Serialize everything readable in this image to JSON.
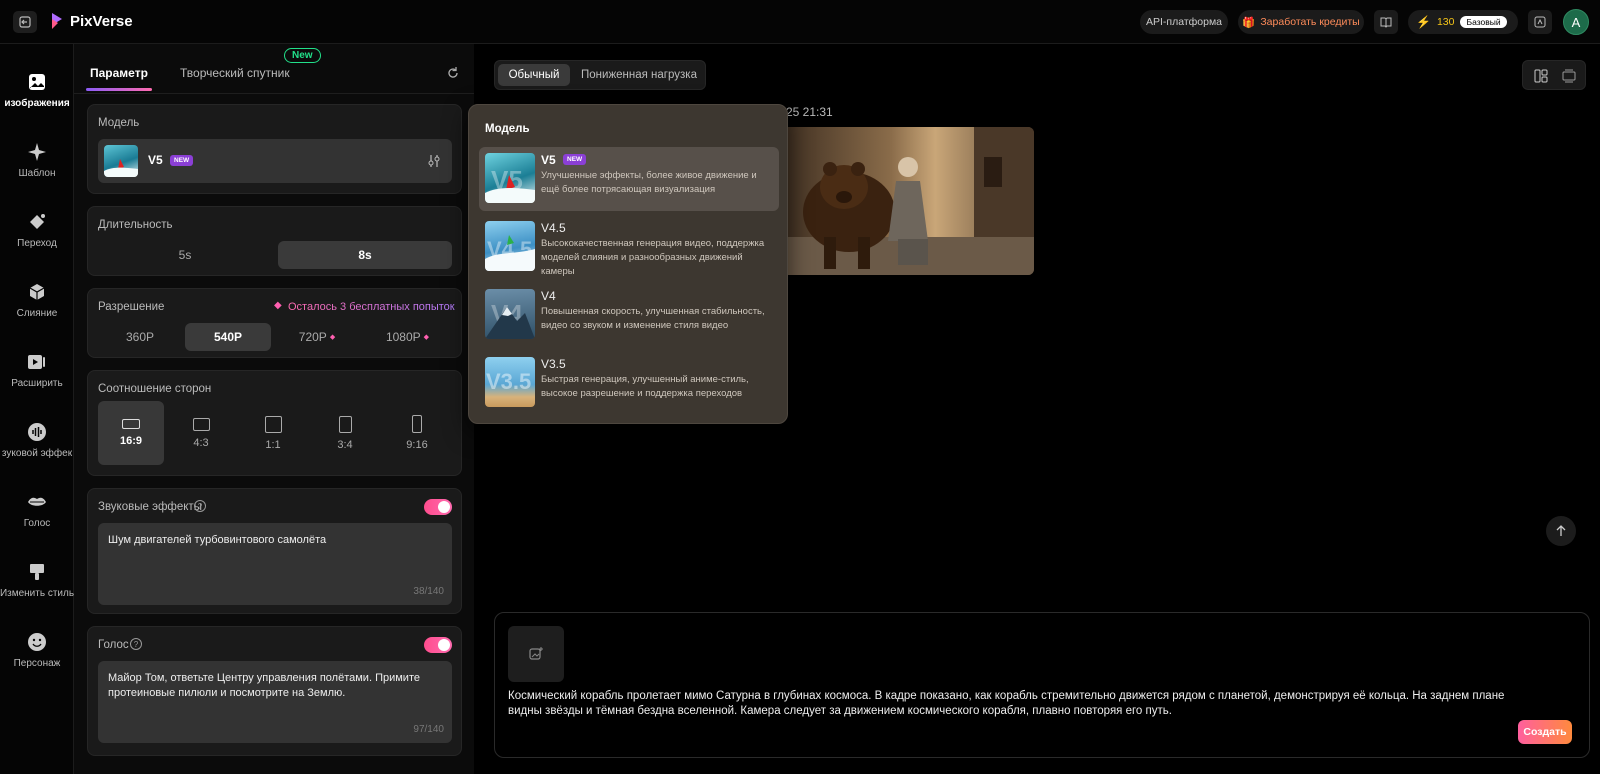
{
  "app": {
    "name": "PixVerse"
  },
  "topbar": {
    "api_label": "API-платформа",
    "earn_label": "Заработать кредиты",
    "credits": "130",
    "plan": "Базовый",
    "avatar_letter": "A"
  },
  "rail": [
    {
      "label": "изображения",
      "icon": "image-icon"
    },
    {
      "label": "Шаблон",
      "icon": "sparkle-icon"
    },
    {
      "label": "Переход",
      "icon": "transition-icon"
    },
    {
      "label": "Слияние",
      "icon": "cube-icon"
    },
    {
      "label": "Расширить",
      "icon": "extend-icon"
    },
    {
      "label": "зуковой эффек",
      "icon": "sound-wave-icon"
    },
    {
      "label": "Голос",
      "icon": "lips-icon"
    },
    {
      "label": "Изменить стиль",
      "icon": "brush-icon"
    },
    {
      "label": "Персонаж",
      "icon": "face-icon"
    }
  ],
  "settings": {
    "tabs": [
      "Параметр",
      "Творческий спутник"
    ],
    "new_badge": "New",
    "model": {
      "label": "Модель",
      "value": "V5",
      "badge": "NEW"
    },
    "duration": {
      "label": "Длительность",
      "options": [
        "5s",
        "8s"
      ],
      "selected": "8s"
    },
    "resolution": {
      "label": "Разрешение",
      "note": "Осталось 3 бесплатных попыток",
      "options": [
        "360P",
        "540P",
        "720P",
        "1080P"
      ],
      "selected": "540P"
    },
    "aspect": {
      "label": "Соотношение сторон",
      "options": [
        "16:9",
        "4:3",
        "1:1",
        "3:4",
        "9:16"
      ],
      "selected": "16:9"
    },
    "sound": {
      "label": "Звуковые эффекты",
      "text": "Шум двигателей турбовинтового самолёта",
      "counter": "38/140",
      "enabled": true
    },
    "voice": {
      "label": "Голос",
      "text": "Майор Том, ответьте Центру управления полётами. Примите протеиновые пилюли и посмотрите на Землю.",
      "counter": "97/140",
      "enabled": true
    }
  },
  "main": {
    "modes": [
      "Обычный",
      "Пониженная нагрузка"
    ],
    "selected_mode": "Обычный",
    "timestamp": "-25 21:31",
    "prompt": "Космический корабль пролетает мимо Сатурна в глубинах космоса. В кадре показано, как корабль стремительно движется рядом с планетой, демонстрируя её кольца. На заднем плане видны звёзды и тёмная бездна вселенной. Камера следует за движением космического корабля, плавно повторяя его путь.",
    "create_label": "Создать"
  },
  "dropdown": {
    "title": "Модель",
    "items": [
      {
        "name": "V5",
        "badge": "NEW",
        "desc": "Улучшенные эффекты, более живое движение и ещё более потрясающая визуализация",
        "active": true
      },
      {
        "name": "V4.5",
        "desc": "Высококачественная генерация видео, поддержка моделей слияния и разнообразных движений камеры"
      },
      {
        "name": "V4",
        "desc": "Повышенная скорость, улучшенная стабильность, видео со звуком и изменение стиля видео"
      },
      {
        "name": "V3.5",
        "desc": "Быстрая генерация, улучшенный аниме-стиль, высокое разрешение и поддержка переходов"
      }
    ]
  },
  "colors": {
    "accent_pink": "#ff4d8d",
    "accent_gradient_end": "#ff8a3d",
    "badge_purple": "#8b3fd6",
    "credits_yellow": "#f5c518"
  }
}
